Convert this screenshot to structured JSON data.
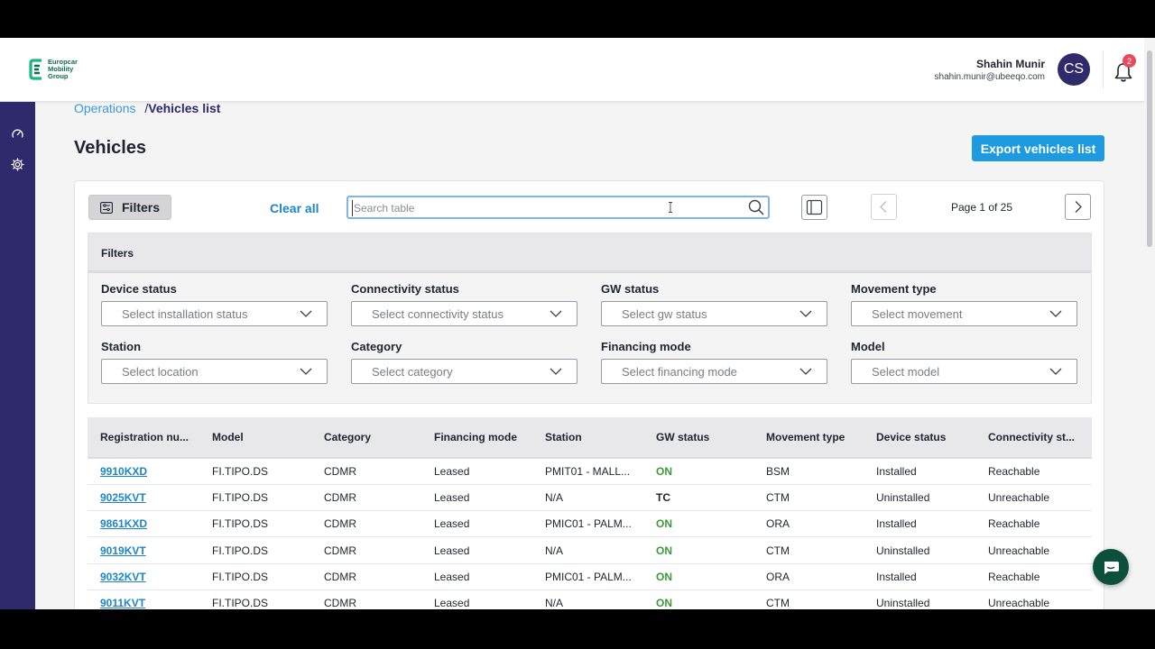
{
  "brand": {
    "logo_lines": [
      "Europcar",
      "Mobility",
      "Group"
    ],
    "color": "#0e6b53"
  },
  "user": {
    "name": "Shahin Munir",
    "email": "shahin.munir@ubeeqo.com",
    "initials": "CS"
  },
  "notifications": {
    "count": "2"
  },
  "breadcrumb": {
    "parent": "Operations",
    "separator": "/",
    "current": "Vehicles list"
  },
  "page": {
    "title": "Vehicles",
    "export_label": "Export vehicles list"
  },
  "toolbar": {
    "filters_label": "Filters",
    "clear_all_label": "Clear all",
    "search_placeholder": "Search table",
    "page_info": "Page 1 of 25"
  },
  "filter_panel": {
    "title": "Filters",
    "fields": [
      {
        "label": "Device status",
        "placeholder": "Select installation status"
      },
      {
        "label": "Connectivity status",
        "placeholder": "Select connectivity status"
      },
      {
        "label": "GW status",
        "placeholder": "Select gw status"
      },
      {
        "label": "Movement type",
        "placeholder": "Select movement"
      },
      {
        "label": "Station",
        "placeholder": "Select location"
      },
      {
        "label": "Category",
        "placeholder": "Select category"
      },
      {
        "label": "Financing mode",
        "placeholder": "Select financing mode"
      },
      {
        "label": "Model",
        "placeholder": "Select model"
      }
    ]
  },
  "table": {
    "columns": [
      "Registration nu...",
      "Model",
      "Category",
      "Financing mode",
      "Station",
      "GW status",
      "Movement type",
      "Device status",
      "Connectivity st..."
    ],
    "rows": [
      [
        "9910KXD",
        "FI.TIPO.DS",
        "CDMR",
        "Leased",
        "PMIT01 - MALL...",
        "ON",
        "BSM",
        "Installed",
        "Reachable"
      ],
      [
        "9025KVT",
        "FI.TIPO.DS",
        "CDMR",
        "Leased",
        "N/A",
        "TC",
        "CTM",
        "Uninstalled",
        "Unreachable"
      ],
      [
        "9861KXD",
        "FI.TIPO.DS",
        "CDMR",
        "Leased",
        "PMIC01 - PALM...",
        "ON",
        "ORA",
        "Installed",
        "Reachable"
      ],
      [
        "9019KVT",
        "FI.TIPO.DS",
        "CDMR",
        "Leased",
        "N/A",
        "ON",
        "CTM",
        "Uninstalled",
        "Unreachable"
      ],
      [
        "9032KVT",
        "FI.TIPO.DS",
        "CDMR",
        "Leased",
        "PMIC01 - PALM...",
        "ON",
        "ORA",
        "Installed",
        "Reachable"
      ],
      [
        "9011KVT",
        "FI.TIPO.DS",
        "CDMR",
        "Leased",
        "N/A",
        "ON",
        "CTM",
        "Uninstalled",
        "Unreachable"
      ]
    ]
  },
  "colors": {
    "sidebar": "#2e2a6b",
    "accent": "#1e9be0",
    "link": "#1e86c8",
    "on_status": "#3a9b3a"
  },
  "icons": [
    "dashboard-icon",
    "settings-icon",
    "bell-icon",
    "search-icon",
    "columns-icon",
    "chevron-left-icon",
    "chevron-right-icon",
    "filter-sliders-icon",
    "chat-icon"
  ]
}
